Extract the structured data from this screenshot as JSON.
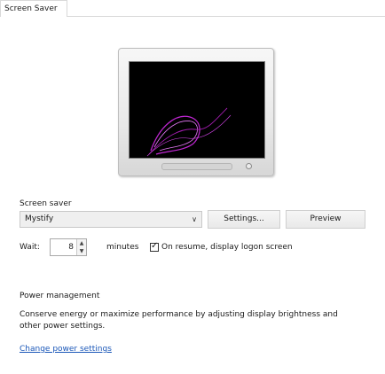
{
  "tab": {
    "label": "Screen Saver"
  },
  "preview": {
    "screensaver": "Mystify"
  },
  "screen_saver_group": {
    "label": "Screen saver",
    "selected": "Mystify",
    "settings_label": "Settings...",
    "preview_label": "Preview",
    "wait_label": "Wait:",
    "wait_value": "8",
    "minutes_label": "minutes",
    "resume_checked": true,
    "resume_label": "On resume, display logon screen"
  },
  "power_group": {
    "label": "Power management",
    "description": "Conserve energy or maximize performance by adjusting display brightness and other power settings.",
    "link_label": "Change power settings"
  },
  "colors": {
    "screen": "#000000",
    "curve": "#c026d3",
    "link": "#1a57b8"
  }
}
